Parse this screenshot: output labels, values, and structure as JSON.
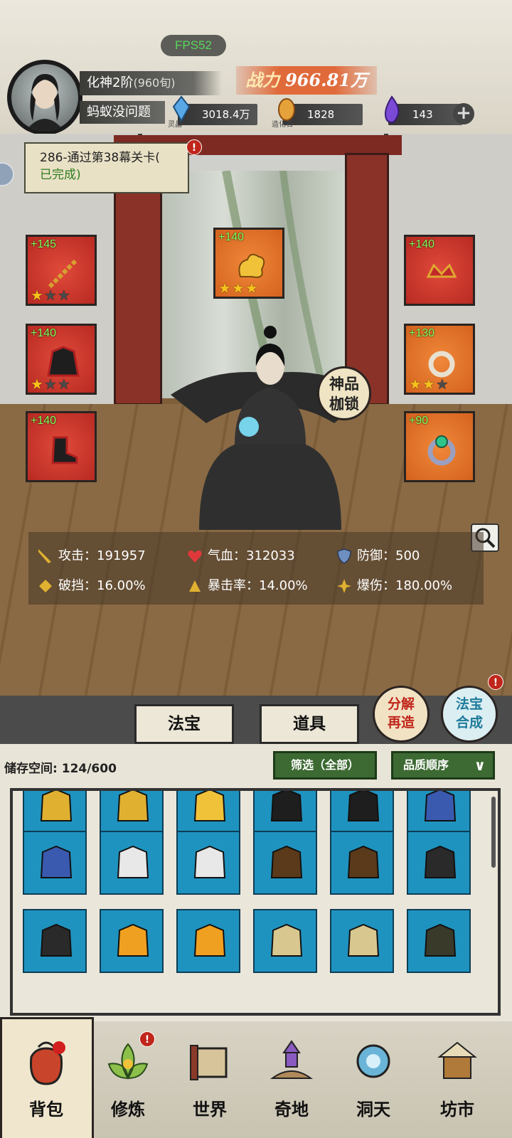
{
  "fps": "FPS52",
  "player": {
    "realm": "化神2阶",
    "realm_sub": "(960旬)",
    "name": "蚂蚁没问题",
    "power_label": "战力",
    "power_value": "966.81万"
  },
  "resources": [
    {
      "name": "灵晶",
      "value": "3018.4万",
      "icon": "blue-crystal-icon",
      "color": "#5aa7e6"
    },
    {
      "name": "造化石",
      "value": "1828",
      "icon": "orange-stone-icon",
      "color": "#e6a23a"
    },
    {
      "name": "",
      "value": "143",
      "icon": "purple-flame-icon",
      "color": "#7a4ad6"
    }
  ],
  "quest": {
    "text": "286-通过第38幕关卡(",
    "status": "已完成)",
    "badge": "!"
  },
  "equipment": [
    {
      "slot": "weapon",
      "level": "+145",
      "stars": 1,
      "icon": "chain-weapon-icon",
      "bg": "red"
    },
    {
      "slot": "head",
      "level": "+140",
      "stars": 3,
      "icon": "golden-cloud-icon",
      "bg": "orange"
    },
    {
      "slot": "crown",
      "level": "+140",
      "stars": 0,
      "icon": "crown-ornament-icon",
      "bg": "red"
    },
    {
      "slot": "armor",
      "level": "+140",
      "stars": 1,
      "icon": "robe-armor-icon",
      "bg": "red"
    },
    {
      "slot": "pendant",
      "level": "+130",
      "stars": 2,
      "icon": "jade-pendant-icon",
      "bg": "orange"
    },
    {
      "slot": "boots",
      "level": "+140",
      "stars": 0,
      "icon": "boots-icon",
      "bg": "red"
    },
    {
      "slot": "ring",
      "level": "+90",
      "stars": 0,
      "icon": "emerald-ring-icon",
      "bg": "orange"
    }
  ],
  "set_button": {
    "line1": "神品",
    "line2": "枷锁"
  },
  "stats": [
    {
      "label": "攻击：",
      "value": "191957",
      "icon": "sword-icon"
    },
    {
      "label": "气血：",
      "value": "312033",
      "icon": "heart-icon"
    },
    {
      "label": "防御：",
      "value": "500",
      "icon": "shield-icon"
    },
    {
      "label": "破挡：",
      "value": "16.00%",
      "icon": "break-icon"
    },
    {
      "label": "暴击率：",
      "value": "14.00%",
      "icon": "crit-icon"
    },
    {
      "label": "爆伤：",
      "value": "180.00%",
      "icon": "crit-damage-icon"
    }
  ],
  "tabs": {
    "treasure": "法宝",
    "items": "道具"
  },
  "round_buttons": {
    "decompose": {
      "line1": "分解",
      "line2": "再造"
    },
    "synth": {
      "line1": "法宝",
      "line2": "合成",
      "badge": "!"
    }
  },
  "inventory": {
    "storage_label": "储存空间:",
    "storage_value": "124/600",
    "filter_label": "筛选（全部）",
    "sort_label": "品质顺序",
    "rows": [
      [
        "chain-weapon-icon",
        "chain-weapon-icon",
        "golden-cloud-icon",
        "robe-armor-icon",
        "robe-armor-icon",
        "blue-robe-icon"
      ],
      [
        "blue-robe-icon",
        "white-robe-icon",
        "white-robe-icon",
        "brown-robe-icon",
        "brown-robe-icon",
        "bracer-icon"
      ],
      [
        "bracer-icon",
        "phoenix-crown-icon",
        "phoenix-crown-icon",
        "winged-boots-icon",
        "winged-boots-icon",
        "dagger-icon"
      ]
    ]
  },
  "nav": [
    {
      "label": "背包",
      "icon": "bag-icon",
      "active": true
    },
    {
      "label": "修炼",
      "icon": "lotus-icon",
      "badge": "!"
    },
    {
      "label": "世界",
      "icon": "scroll-map-icon"
    },
    {
      "label": "奇地",
      "icon": "pagoda-icon"
    },
    {
      "label": "洞天",
      "icon": "portal-icon"
    },
    {
      "label": "坊市",
      "icon": "market-icon"
    }
  ]
}
